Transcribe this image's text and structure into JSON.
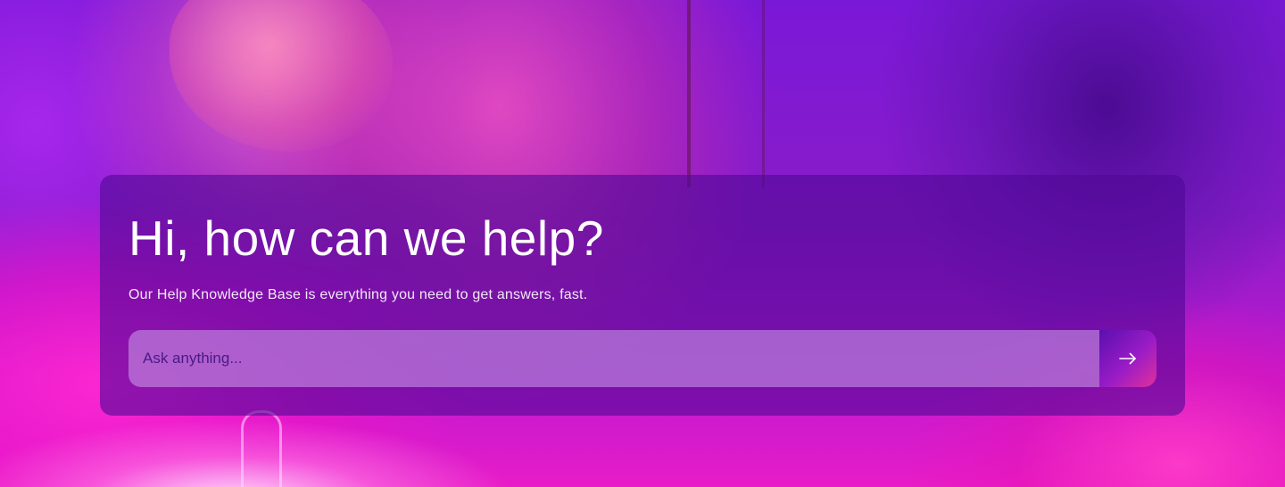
{
  "hero": {
    "title": "Hi, how can we help?",
    "subtitle": "Our Help Knowledge Base is everything you need to get answers, fast."
  },
  "search": {
    "placeholder": "Ask anything...",
    "value": "",
    "submit_icon": "arrow-right-icon"
  },
  "colors": {
    "card_overlay": "#50089a",
    "input_background": "#cda0eb",
    "placeholder_text": "#4a1a86",
    "button_gradient_start": "#5a0fb0",
    "button_gradient_end": "#e0309a",
    "title_text": "#ffffff"
  }
}
